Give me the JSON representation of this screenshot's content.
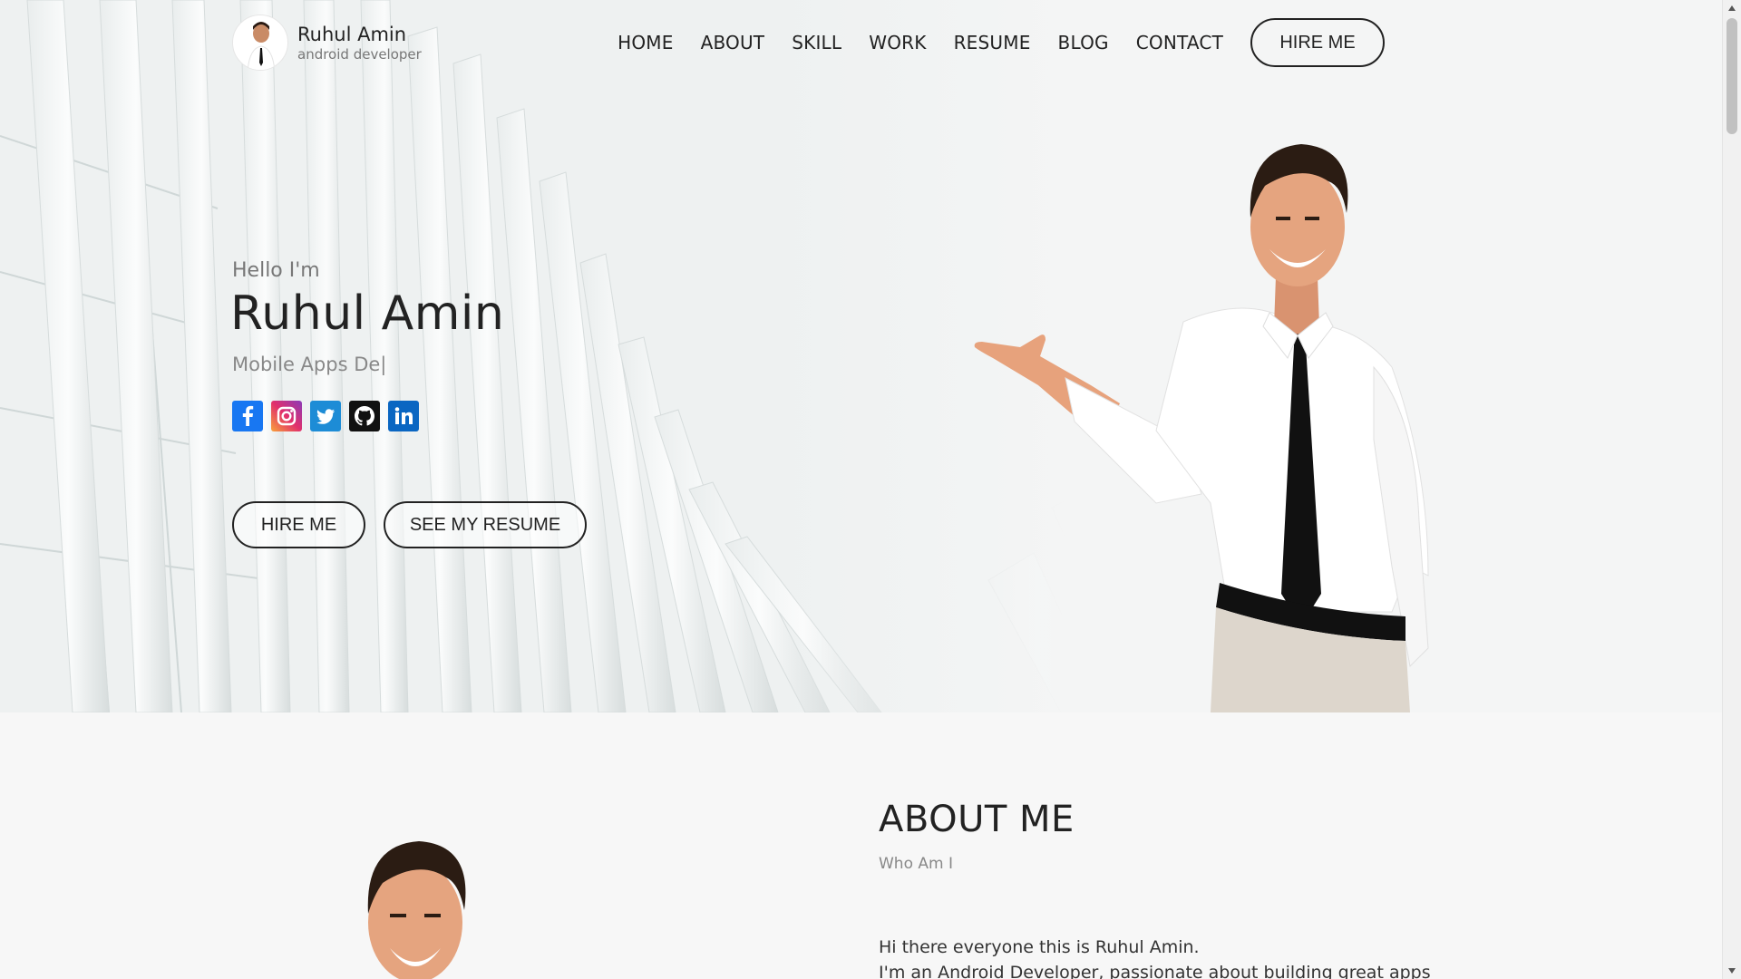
{
  "brand": {
    "name": "Ruhul Amin",
    "role": "android developer"
  },
  "nav": {
    "items": [
      {
        "label": "HOME"
      },
      {
        "label": "ABOUT"
      },
      {
        "label": "SKILL"
      },
      {
        "label": "WORK"
      },
      {
        "label": "RESUME"
      },
      {
        "label": "BLOG"
      },
      {
        "label": "CONTACT"
      }
    ],
    "cta_label": "HIRE ME"
  },
  "hero": {
    "greeting": "Hello I'm",
    "name": "Ruhul Amin",
    "typed_text": "Mobile Apps De|",
    "socials": [
      {
        "icon": "facebook-icon",
        "color": "#1877f2"
      },
      {
        "icon": "instagram-icon",
        "color": "#e1306c"
      },
      {
        "icon": "twitter-icon",
        "color": "#1da1f2"
      },
      {
        "icon": "github-icon",
        "color": "#111111"
      },
      {
        "icon": "linkedin-icon",
        "color": "#0a66c2"
      }
    ],
    "hire_label": "HIRE ME",
    "resume_label": "SEE MY RESUME"
  },
  "about": {
    "title": "ABOUT ME",
    "subtitle": "Who Am I",
    "line1": "Hi there everyone this is Ruhul Amin.",
    "line2": "I'm an Android Developer, passionate about building great apps"
  }
}
